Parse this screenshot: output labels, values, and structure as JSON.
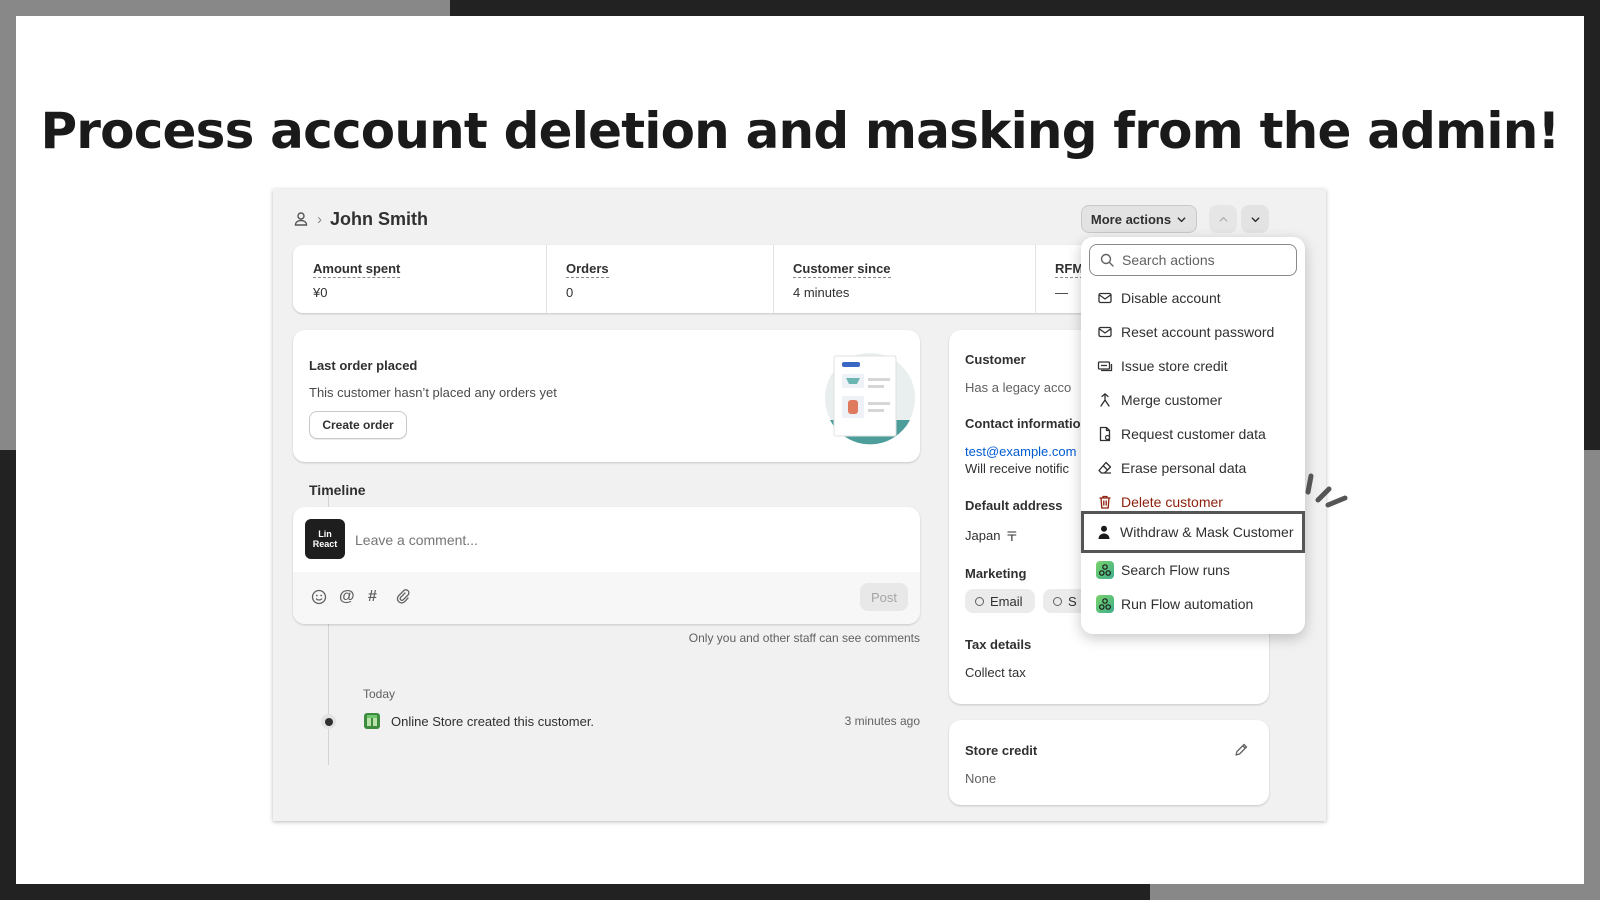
{
  "headline": "Process account deletion and masking from the admin!",
  "customer": {
    "name": "John Smith",
    "breadcrumb_separator": "›"
  },
  "toolbar": {
    "more_actions_label": "More actions"
  },
  "metrics": [
    {
      "label": "Amount spent",
      "value": "¥0"
    },
    {
      "label": "Orders",
      "value": "0"
    },
    {
      "label": "Customer since",
      "value": "4 minutes"
    },
    {
      "label": "RFM",
      "value": "—"
    }
  ],
  "last_order": {
    "title": "Last order placed",
    "message": "This customer hasn’t placed any orders yet",
    "button": "Create order"
  },
  "timeline": {
    "title": "Timeline",
    "avatar_text": "Lin React",
    "comment_placeholder": "Leave a comment...",
    "post_button": "Post",
    "staff_note": "Only you and other staff can see comments",
    "day_label": "Today",
    "events": [
      {
        "text": "Online Store created this customer.",
        "time": "3 minutes ago"
      }
    ]
  },
  "customer_panel": {
    "title": "Customer",
    "legacy_text": "Has a legacy acco",
    "contact_title": "Contact informatio",
    "email": "test@example.com",
    "notification_text": "Will receive notific",
    "address_title": "Default address",
    "address_value": "Japan",
    "marketing_title": "Marketing",
    "marketing_chips": [
      "Email",
      "S"
    ],
    "tax_title": "Tax details",
    "tax_value": "Collect tax"
  },
  "store_credit": {
    "title": "Store credit",
    "value": "None"
  },
  "actions_menu": {
    "search_placeholder": "Search actions",
    "items": [
      {
        "label": "Disable account",
        "icon": "envelope-icon"
      },
      {
        "label": "Reset account password",
        "icon": "envelope-icon"
      },
      {
        "label": "Issue store credit",
        "icon": "cash-icon"
      },
      {
        "label": "Merge customer",
        "icon": "merge-icon"
      },
      {
        "label": "Request customer data",
        "icon": "file-icon"
      },
      {
        "label": "Erase personal data",
        "icon": "eraser-icon"
      },
      {
        "label": "Delete customer",
        "icon": "trash-icon"
      },
      {
        "label": "Withdraw & Mask Customer",
        "icon": "person-icon"
      },
      {
        "label": "Search Flow runs",
        "icon": "flow-icon"
      },
      {
        "label": "Run Flow automation",
        "icon": "flow-icon"
      }
    ]
  },
  "colors": {
    "danger": "#8e1f0b",
    "link": "#005bd3",
    "highlight_border": "#555555"
  }
}
